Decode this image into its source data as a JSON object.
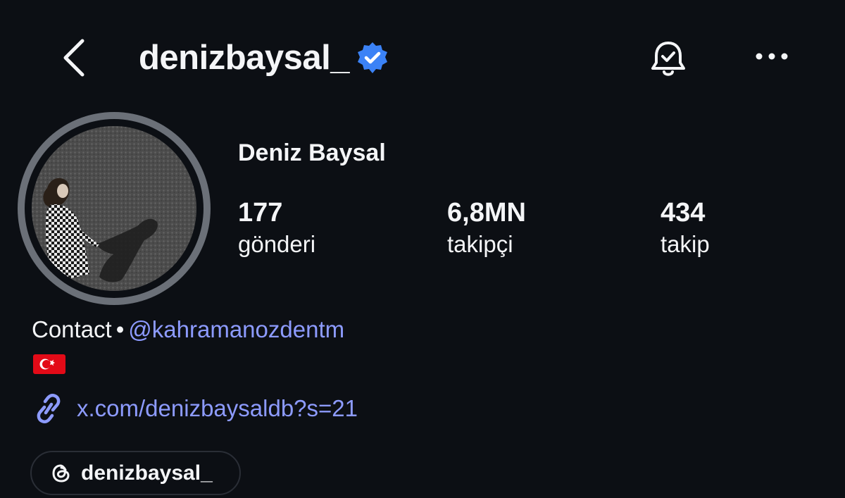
{
  "header": {
    "username": "denizbaysal_",
    "verified": true,
    "back_icon": "chevron-left-icon",
    "bell_icon": "notification-bell-icon",
    "more_icon": "more-horizontal-icon",
    "verified_color": "#3b82f6"
  },
  "profile": {
    "display_name": "Deniz Baysal",
    "stats": [
      {
        "value": "177",
        "label": "gönderi"
      },
      {
        "value": "6,8MN",
        "label": "takipçi"
      },
      {
        "value": "434",
        "label": "takip"
      }
    ]
  },
  "bio": {
    "contact_label": "Contact",
    "separator": "•",
    "mention": "@kahramanozdentm",
    "flag": "turkey-flag",
    "link_icon": "link-icon",
    "link": "x.com/denizbaysaldb?s=21",
    "link_color": "#8d9bff"
  },
  "threads": {
    "icon": "threads-icon",
    "label": "denizbaysal_"
  }
}
